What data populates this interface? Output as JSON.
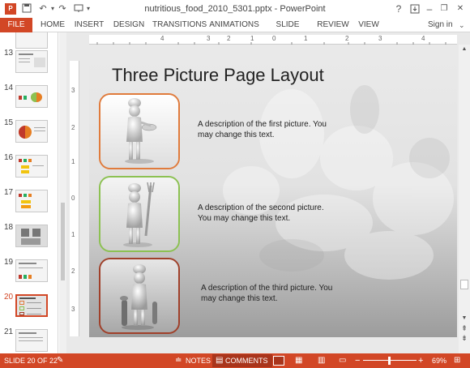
{
  "window": {
    "title": "nutritious_food_2010_5301.pptx - PowerPoint",
    "sign_in": "Sign in",
    "help": "?",
    "minimize": "–",
    "restore": "❐",
    "close": "✕"
  },
  "ribbon": {
    "tabs": [
      "FILE",
      "HOME",
      "INSERT",
      "DESIGN",
      "TRANSITIONS",
      "ANIMATIONS",
      "SLIDE SHOW",
      "REVIEW",
      "VIEW"
    ]
  },
  "ruler": {
    "h_labels": [
      "4",
      "3",
      "2",
      "1",
      "0",
      "1",
      "2",
      "3",
      "4"
    ],
    "v_labels": [
      "3",
      "2",
      "1",
      "0",
      "1",
      "2",
      "3"
    ]
  },
  "thumbnails": [
    {
      "num": "13",
      "selected": false
    },
    {
      "num": "14",
      "selected": false
    },
    {
      "num": "15",
      "selected": false
    },
    {
      "num": "16",
      "selected": false
    },
    {
      "num": "17",
      "selected": false
    },
    {
      "num": "18",
      "selected": false
    },
    {
      "num": "19",
      "selected": false
    },
    {
      "num": "20",
      "selected": true
    },
    {
      "num": "21",
      "selected": false
    }
  ],
  "slide": {
    "title": "Three Picture Page Layout",
    "pictures": [
      {
        "desc_line1": "A description of the first picture.  You",
        "desc_line2": "may change this text.",
        "border_color": "#e07b3c"
      },
      {
        "desc_line1": "A description of the second picture.",
        "desc_line2": "You may change this text.",
        "border_color": "#8cc152"
      },
      {
        "desc_line1": "A description of the third picture.  You",
        "desc_line2": "may change this text.",
        "border_color": "#a0402a"
      }
    ]
  },
  "status": {
    "slide_info": "SLIDE 20 OF 22",
    "notes": "NOTES",
    "comments": "COMMENTS",
    "zoom": "69%"
  },
  "colors": {
    "accent": "#d24726"
  }
}
